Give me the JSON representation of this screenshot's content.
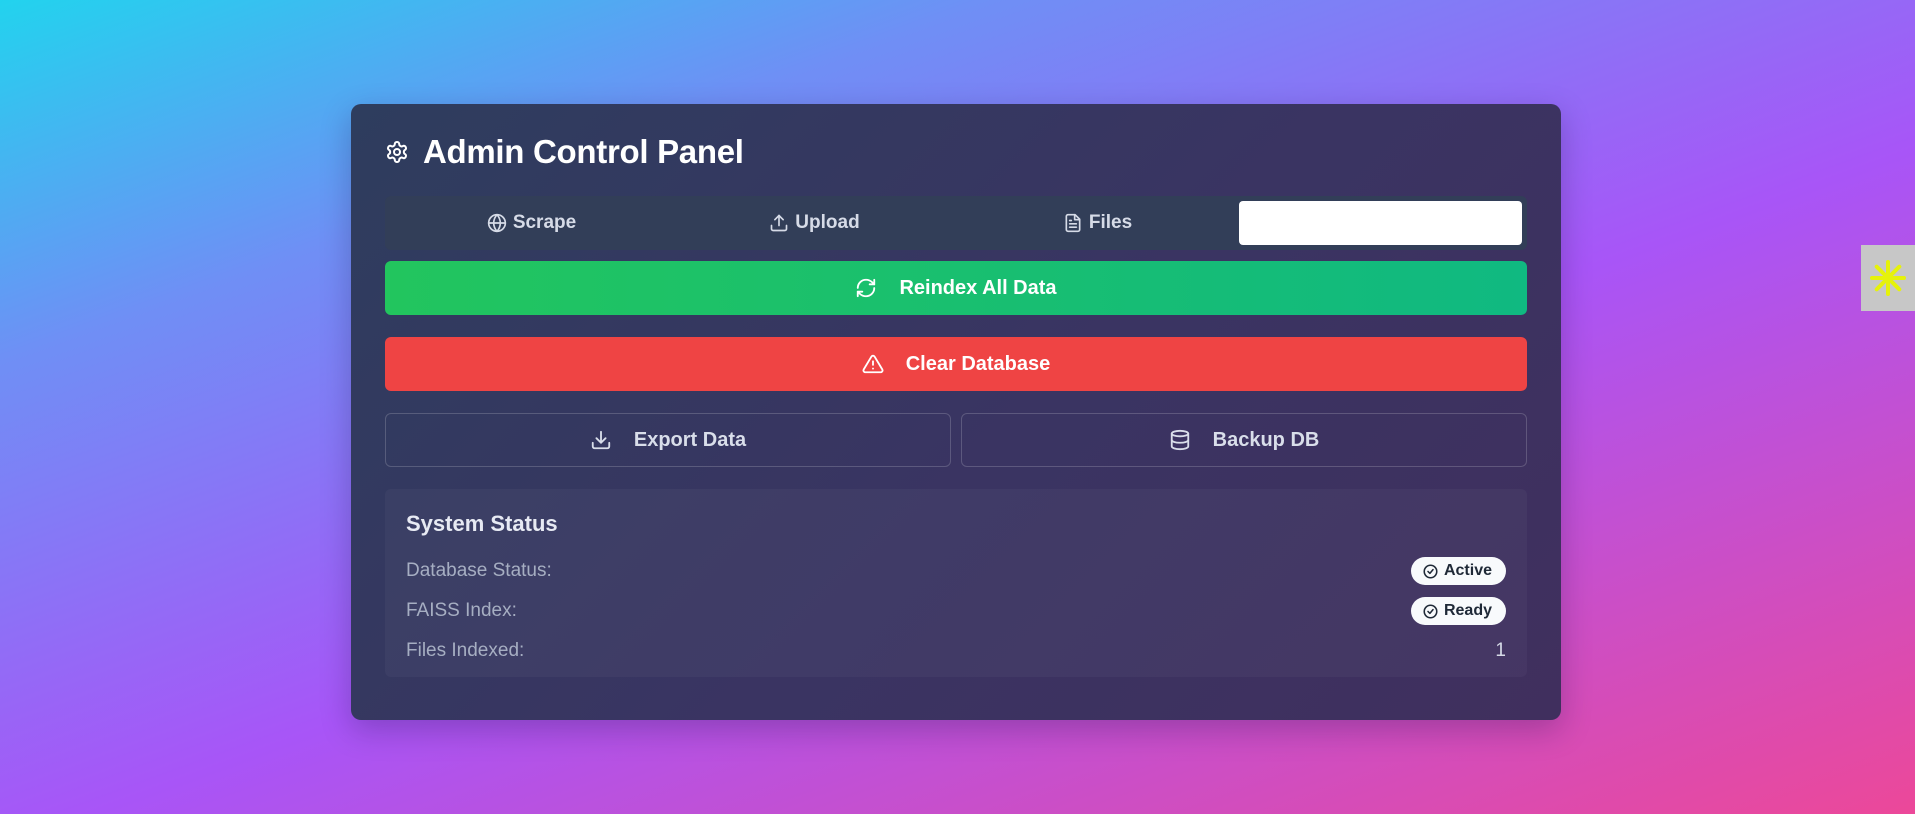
{
  "app": {
    "title": "Admin Control Panel",
    "title_icon": "gear-icon"
  },
  "tabs": [
    {
      "label": "Scrape",
      "icon": "globe-icon"
    },
    {
      "label": "Upload",
      "icon": "upload-icon"
    },
    {
      "label": "Files",
      "icon": "file-icon"
    },
    {
      "label": "",
      "active": true
    }
  ],
  "actions": {
    "reindex_label": "Reindex All Data",
    "clear_label": "Clear Database",
    "export_label": "Export Data",
    "backup_label": "Backup DB"
  },
  "status": {
    "title": "System Status",
    "rows": [
      {
        "label": "Database Status:",
        "badge": "Active"
      },
      {
        "label": "FAISS Index:",
        "badge": "Ready"
      },
      {
        "label": "Files Indexed:",
        "value": "1"
      }
    ]
  },
  "colors": {
    "reindex": "#22c55e",
    "clear": "#ef4444",
    "panel": "#2e3d5e",
    "side_widget_icon": "#e6f20a"
  }
}
